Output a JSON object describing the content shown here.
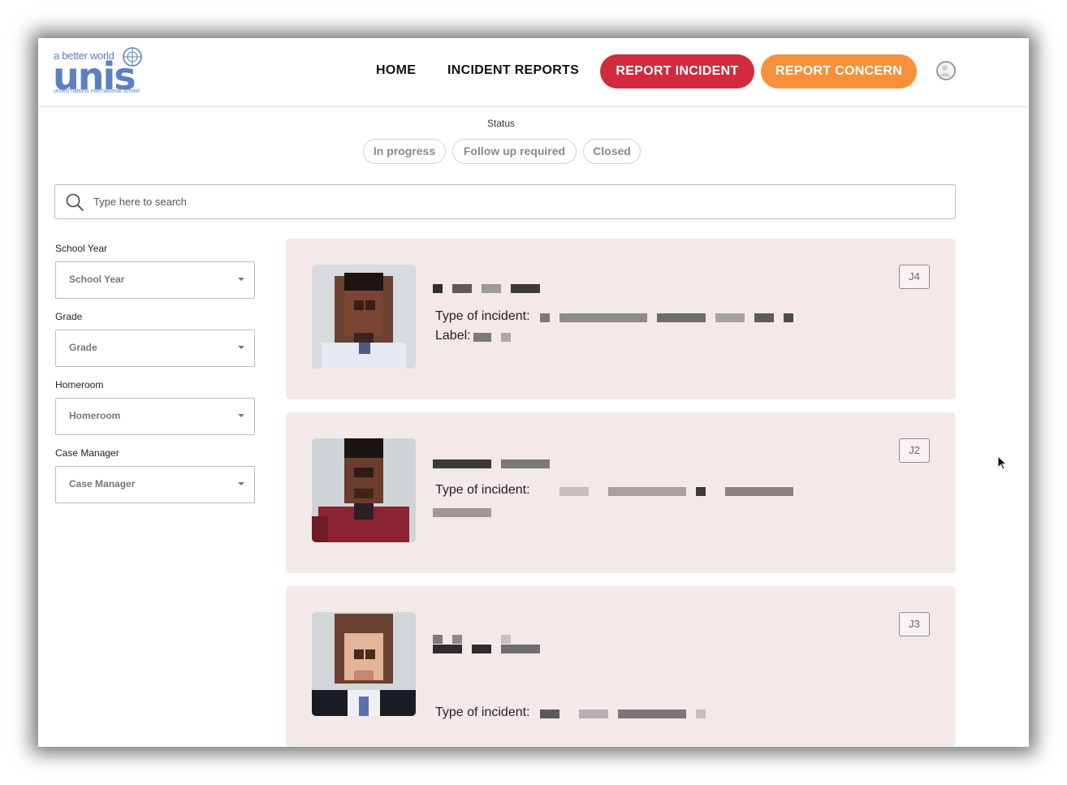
{
  "logo": {
    "tagline": "a better world",
    "wordmark": "unis",
    "subtitle": "united nations international school"
  },
  "nav": {
    "home": "HOME",
    "incident_reports": "INCIDENT REPORTS",
    "report_incident": "REPORT INCIDENT",
    "report_concern": "REPORT CONCERN"
  },
  "status": {
    "label": "Status",
    "chips": [
      "In progress",
      "Follow up required",
      "Closed"
    ]
  },
  "search": {
    "placeholder": "Type here to search"
  },
  "filters": [
    {
      "label": "School Year",
      "value": "School Year"
    },
    {
      "label": "Grade",
      "value": "Grade"
    },
    {
      "label": "Homeroom",
      "value": "Homeroom"
    },
    {
      "label": "Case Manager",
      "value": "Case Manager"
    }
  ],
  "cards": [
    {
      "grade": "J4",
      "type_label": "Type of incident:",
      "extra_label": "Label:"
    },
    {
      "grade": "J2",
      "type_label": "Type of incident:"
    },
    {
      "grade": "J3",
      "type_label": "Type of incident:"
    }
  ],
  "colors": {
    "report_incident": "#d22a3f",
    "report_concern": "#f7903a",
    "card_bg": "#f4e9e9",
    "brand_blue": "#5b7fc1"
  }
}
